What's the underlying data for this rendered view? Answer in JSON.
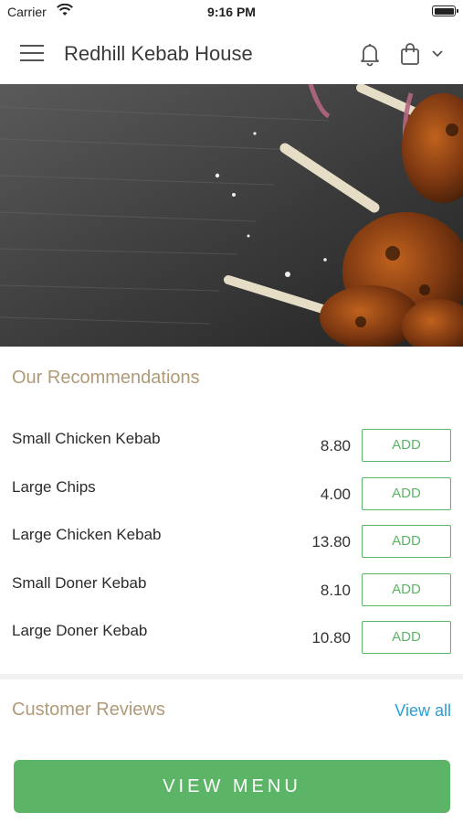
{
  "status_bar": {
    "carrier": "Carrier",
    "time": "9:16 PM"
  },
  "nav": {
    "title": "Redhill Kebab House",
    "icons": [
      "menu-icon",
      "bell-icon",
      "shopping-bag-icon",
      "chevron-down-icon"
    ]
  },
  "recommendations": {
    "title": "Our Recommendations",
    "add_label": "ADD",
    "items": [
      {
        "name": "Small Chicken Kebab",
        "price": "8.80"
      },
      {
        "name": "Large Chips",
        "price": "4.00"
      },
      {
        "name": "Large Chicken Kebab",
        "price": "13.80"
      },
      {
        "name": "Small Doner Kebab",
        "price": "8.10"
      },
      {
        "name": "Large Doner Kebab",
        "price": "10.80"
      }
    ]
  },
  "reviews": {
    "title": "Customer Reviews",
    "view_all": "View all"
  },
  "footer": {
    "view_menu": "VIEW MENU"
  },
  "colors": {
    "accent_green": "#5cb567",
    "section_title": "#b09a78",
    "link_blue": "#2a9fd8"
  }
}
